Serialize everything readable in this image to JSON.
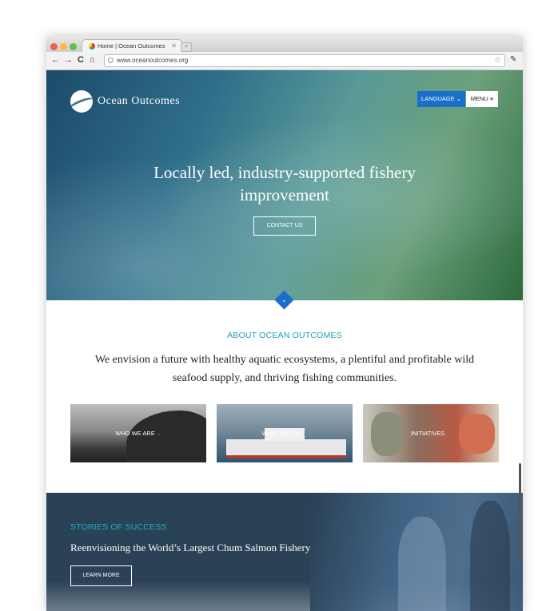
{
  "browser": {
    "tab_title": "Home | Ocean Outcomes",
    "tab_close": "✕",
    "new_tab": "+",
    "url": "www.oceanoutcomes.org",
    "nav": {
      "back": "←",
      "forward": "→",
      "reload": "C",
      "home": "⌂"
    },
    "star": "☆",
    "wrench": "✎",
    "traffic_lights": [
      "#ec5f52",
      "#f5be3f",
      "#5fc04d"
    ]
  },
  "header": {
    "logo_text": "Ocean Outcomes",
    "language_label": "LANGUAGE ⌄",
    "menu_label": "MENU ≡"
  },
  "hero": {
    "title": "Locally led, industry-supported fishery improvement",
    "cta_label": "CONTACT US",
    "scroll_icon": "⌄"
  },
  "about": {
    "heading": "ABOUT OCEAN OUTCOMES",
    "text": "We envision a future with healthy aquatic ecosystems, a plentiful and profitable wild seafood supply, and thriving fishing communities.",
    "cards": [
      {
        "label": "WHO WE ARE",
        "chevron": "⌄"
      },
      {
        "label": "WHAT WE DO",
        "chevron": "⌄"
      },
      {
        "label": "INITIATIVES",
        "chevron": "⌄"
      }
    ]
  },
  "stories": {
    "heading": "STORIES OF SUCCESS",
    "title": "Reenvisioning the World’s Largest Chum Salmon Fishery",
    "cta_label": "LEARN MORE"
  },
  "colors": {
    "accent_blue": "#1a6fcb",
    "teal_heading": "#1d9fb3",
    "stories_bg": "#2a4156"
  }
}
